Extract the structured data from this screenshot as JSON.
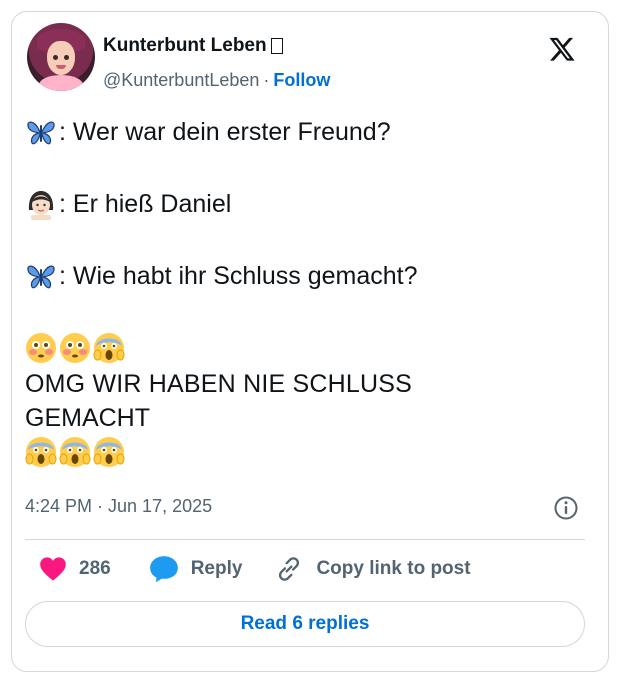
{
  "user": {
    "display_name": "Kunterbunt Leben",
    "handle": "@KunterbuntLeben",
    "separator": "·",
    "follow_label": "Follow"
  },
  "tweet": {
    "line1": ": Wer war dein erster Freund?",
    "line2": ": Er hieß Daniel",
    "line3": ": Wie habt ihr Schluss gemacht?",
    "omg_line1": "OMG WIR HABEN NIE SCHLUSS",
    "omg_line2": "GEMACHT"
  },
  "timestamp": "4:24 PM · Jun 17, 2025",
  "actions": {
    "like_count": "286",
    "reply_label": "Reply",
    "copy_label": "Copy link to post"
  },
  "read_replies_label": "Read 6 replies",
  "icons": {
    "logo": "x-logo-icon",
    "butterfly": "butterfly-emoji-icon",
    "woman": "woman-emoji-icon",
    "flushed": "flushed-face-emoji-icon",
    "scream": "screaming-in-fear-emoji-icon",
    "heart": "heart-icon",
    "reply": "reply-bubble-icon",
    "link": "link-icon",
    "info": "info-icon"
  },
  "colors": {
    "accent_blue": "#006fd6",
    "like_pink": "#f91880",
    "reply_blue": "#1d9bf0",
    "muted_text": "#536471",
    "border": "#cfd9de"
  }
}
